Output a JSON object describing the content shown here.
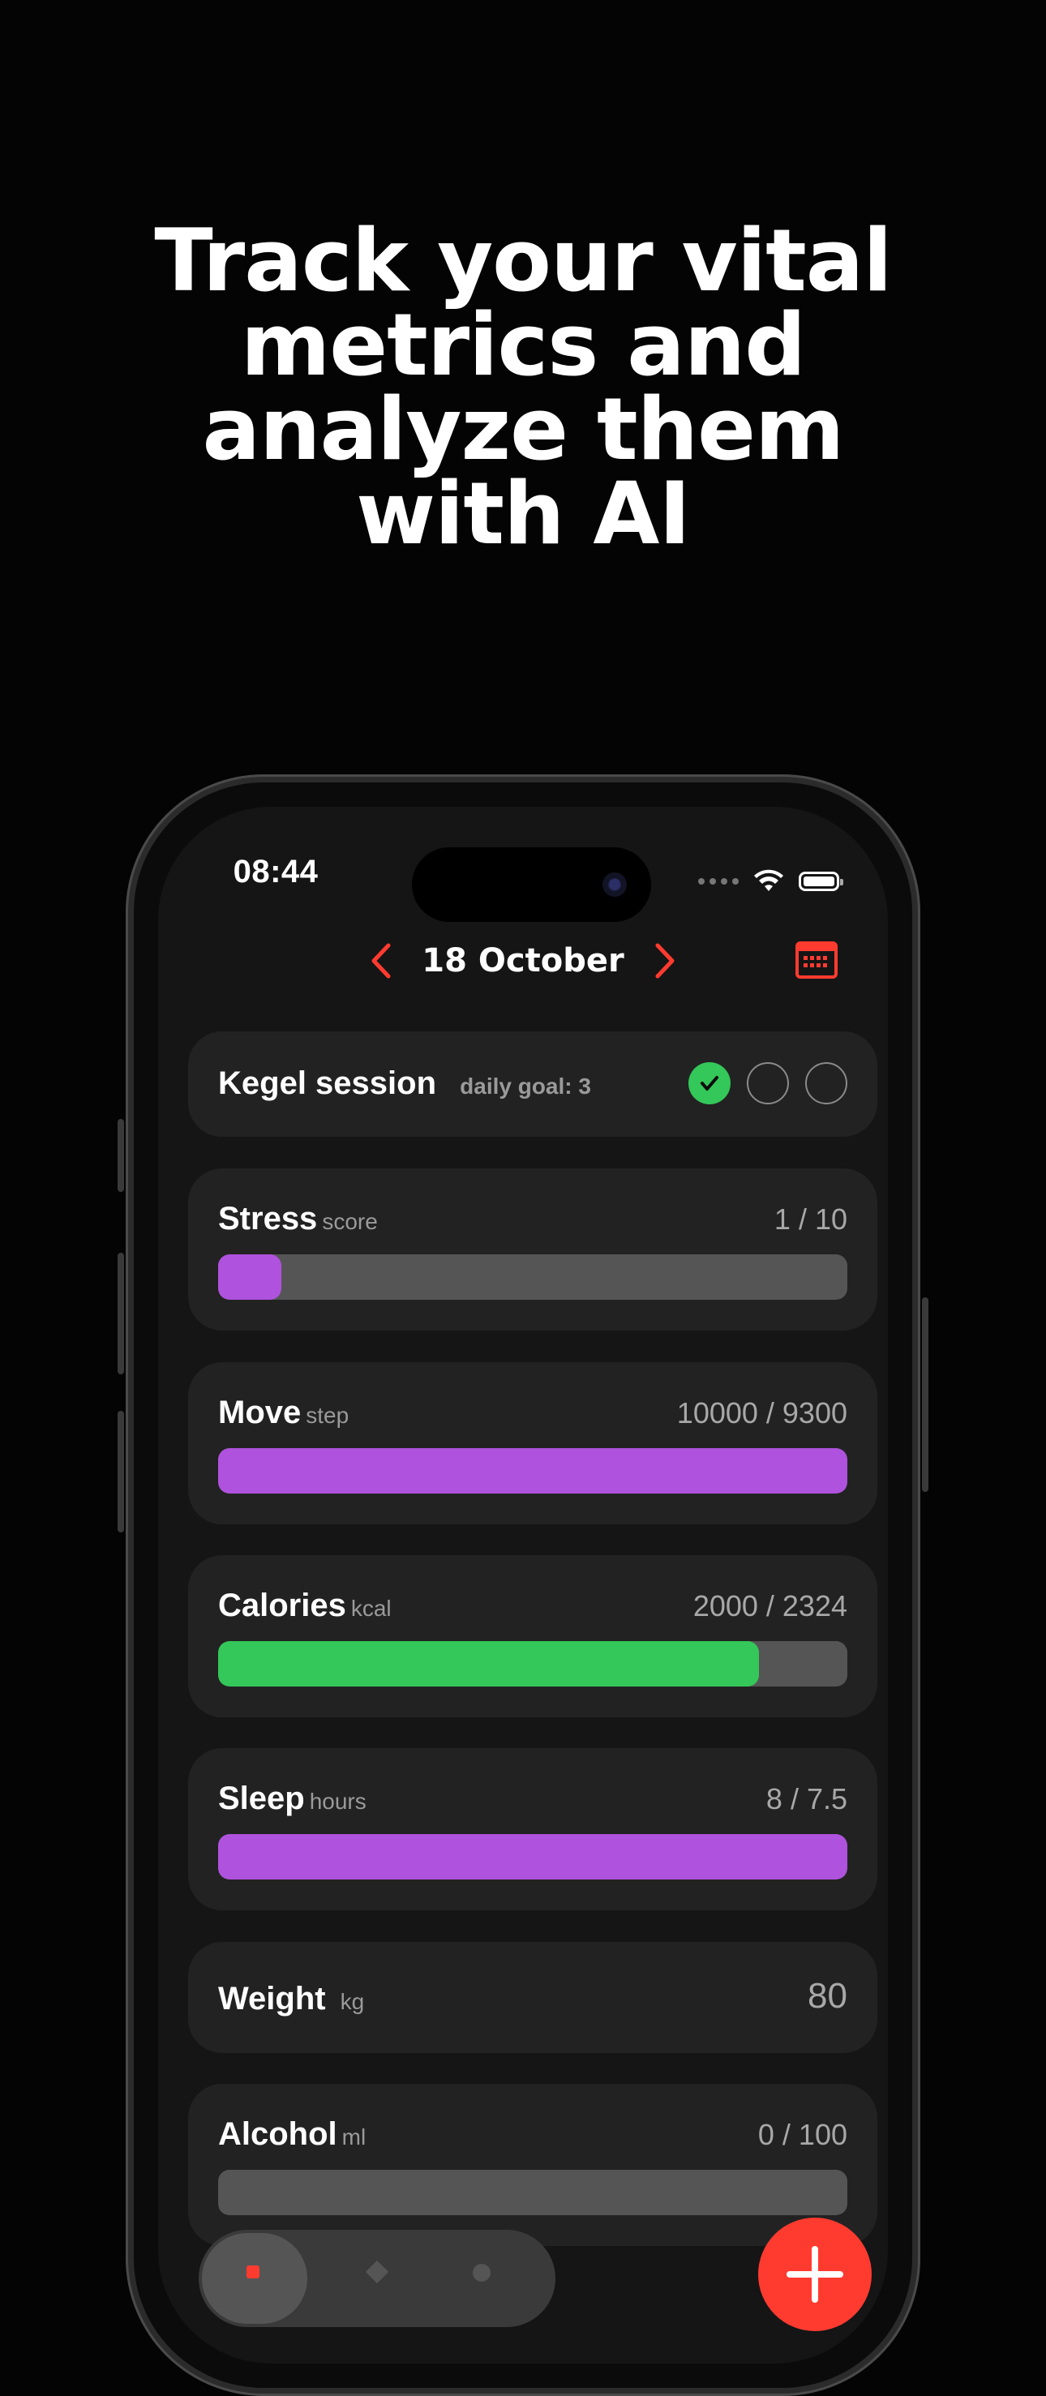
{
  "headline": {
    "lines": [
      "Track your vital",
      "metrics and",
      "analyze them",
      "with AI"
    ]
  },
  "status_bar": {
    "time": "08:44"
  },
  "date_nav": {
    "label": "18 October"
  },
  "colors": {
    "accent": "#ff3b30",
    "purple": "#af52de",
    "green": "#34c759",
    "track": "#555555",
    "card": "#222222"
  },
  "kegel": {
    "title": "Kegel session",
    "goal_label": "daily goal: 3",
    "completed": 1,
    "goal": 3
  },
  "metrics": [
    {
      "title": "Stress",
      "unit": "score",
      "value": "1 / 10",
      "progress": 0.1,
      "color": "purple"
    },
    {
      "title": "Move",
      "unit": "step",
      "value": "10000 / 9300",
      "progress": 1.0,
      "color": "purple"
    },
    {
      "title": "Calories",
      "unit": "kcal",
      "value": "2000 / 2324",
      "progress": 0.86,
      "color": "green"
    },
    {
      "title": "Sleep",
      "unit": "hours",
      "value": "8 / 7.5",
      "progress": 1.0,
      "color": "purple"
    }
  ],
  "weight": {
    "title": "Weight",
    "unit": "kg",
    "value": "80"
  },
  "alcohol": {
    "title": "Alcohol",
    "unit": "ml",
    "value": "0 / 100",
    "progress": 0.0
  },
  "icons": {
    "prev": "chevron-left-icon",
    "next": "chevron-right-icon",
    "calendar": "calendar-icon",
    "check": "check-icon",
    "wifi": "wifi-icon",
    "battery": "battery-icon",
    "add": "plus-icon"
  }
}
